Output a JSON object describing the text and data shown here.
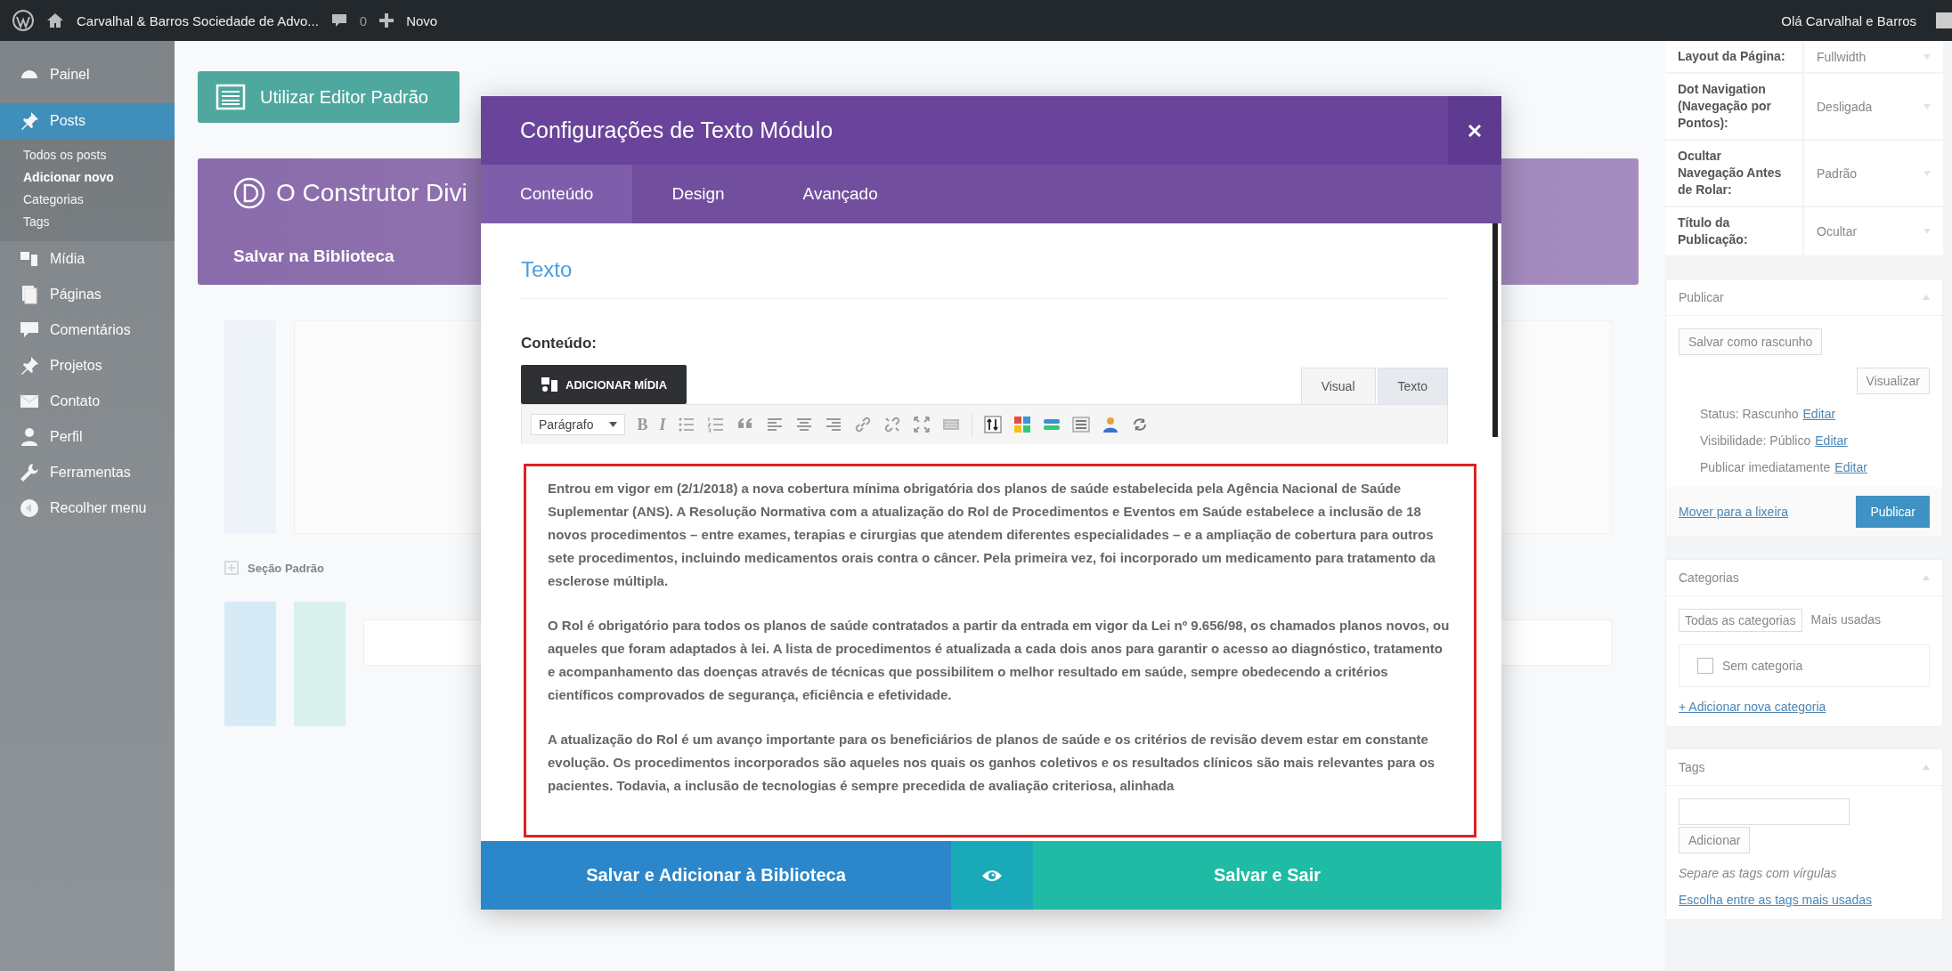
{
  "admin_bar": {
    "site_name": "Carvalhal & Barros Sociedade de Advo...",
    "comments_count": "0",
    "new_label": "Novo",
    "greeting": "Olá Carvalhal e Barros"
  },
  "sidebar": {
    "items": [
      {
        "label": "Painel",
        "selected": false
      },
      {
        "label": "Posts",
        "selected": true,
        "children": [
          {
            "label": "Todos os posts",
            "selected": false
          },
          {
            "label": "Adicionar novo",
            "selected": true
          },
          {
            "label": "Categorias",
            "selected": false
          },
          {
            "label": "Tags",
            "selected": false
          }
        ]
      },
      {
        "label": "Mídia",
        "selected": false
      },
      {
        "label": "Páginas",
        "selected": false
      },
      {
        "label": "Comentários",
        "selected": false
      },
      {
        "label": "Projetos",
        "selected": false
      },
      {
        "label": "Contato",
        "selected": false
      },
      {
        "label": "Perfil",
        "selected": false
      },
      {
        "label": "Ferramentas",
        "selected": false
      },
      {
        "label": "Recolher menu",
        "selected": false
      }
    ]
  },
  "builder": {
    "editor_button": "Utilizar Editor Padrão",
    "title": "O Construtor Divi",
    "save_library": "Salvar na Biblioteca",
    "section_link": "Seção Padrão"
  },
  "modal": {
    "title": "Configurações de Texto Módulo",
    "tabs": [
      {
        "label": "Conteúdo",
        "selected": true
      },
      {
        "label": "Design",
        "selected": false
      },
      {
        "label": "Avançado",
        "selected": false
      }
    ],
    "section_title": "Texto",
    "field_label": "Conteúdo:",
    "add_media": "ADICIONAR MÍDIA",
    "editor_tabs": [
      {
        "label": "Visual",
        "selected": true
      },
      {
        "label": "Texto",
        "selected": false
      }
    ],
    "toolbar": {
      "format": "Parágrafo",
      "bold": "B",
      "italic": "I"
    },
    "paragraphs": [
      "Entrou em vigor em (2/1/2018) a nova cobertura mínima obrigatória dos planos de saúde estabelecida pela Agência Nacional de Saúde Suplementar (ANS). A Resolução Normativa com a atualização do Rol de Procedimentos e Eventos em Saúde estabelece a inclusão de 18 novos procedimentos – entre exames, terapias e cirurgias que atendem diferentes especialidades – e a ampliação de cobertura para outros sete procedimentos, incluindo medicamentos orais contra o câncer. Pela primeira vez, foi incorporado um medicamento para tratamento da esclerose múltipla.",
      "O Rol é obrigatório para todos os planos de saúde contratados a partir da entrada em vigor da Lei nº 9.656/98, os chamados planos novos, ou aqueles que foram adaptados à lei. A lista de procedimentos é atualizada a cada dois anos para garantir o acesso ao diagnóstico, tratamento e acompanhamento das doenças através de técnicas que possibilitem o melhor resultado em saúde, sempre obedecendo a critérios científicos comprovados de segurança, eficiência e efetividade.",
      "A atualização do Rol é um avanço importante para os beneficiários de planos de saúde e os critérios de revisão devem estar em constante evolução. Os procedimentos incorporados são aqueles nos quais os ganhos coletivos e os resultados clínicos são mais relevantes para os pacientes. Todavia, a inclusão de tecnologias é sempre precedida de avaliação criteriosa, alinhada"
    ],
    "buttons": {
      "save_library": "Salvar e Adicionar à Biblioteca",
      "save_exit": "Salvar e Sair"
    }
  },
  "right_panel": {
    "page_settings": [
      {
        "label": "Layout da Página:",
        "value": "Fullwidth"
      },
      {
        "label": "Dot Navigation (Navegação por Pontos):",
        "value": "Desligada"
      },
      {
        "label": "Ocultar Navegação Antes de Rolar:",
        "value": "Padrão"
      },
      {
        "label": "Título da Publicação:",
        "value": "Ocultar"
      }
    ],
    "publish": {
      "title": "Publicar",
      "save_draft": "Salvar como rascunho",
      "preview": "Visualizar",
      "rows": [
        {
          "text": "Status: Rascunho",
          "link": "Editar"
        },
        {
          "text": "Visibilidade: Público",
          "link": "Editar"
        },
        {
          "text": "Publicar imediatamente",
          "link": "Editar"
        }
      ],
      "trash": "Mover para a lixeira",
      "publish_button": "Publicar"
    },
    "categories": {
      "title": "Categorias",
      "tabs": [
        {
          "label": "Todas as categorias",
          "selected": true
        },
        {
          "label": "Mais usadas",
          "selected": false
        }
      ],
      "items": [
        {
          "label": "Sem categoria",
          "checked": false
        }
      ],
      "add_link": "+ Adicionar nova categoria"
    },
    "tags": {
      "title": "Tags",
      "add_button": "Adicionar",
      "hint": "Separe as tags com vírgulas",
      "choose_link": "Escolha entre as tags mais usadas"
    }
  }
}
